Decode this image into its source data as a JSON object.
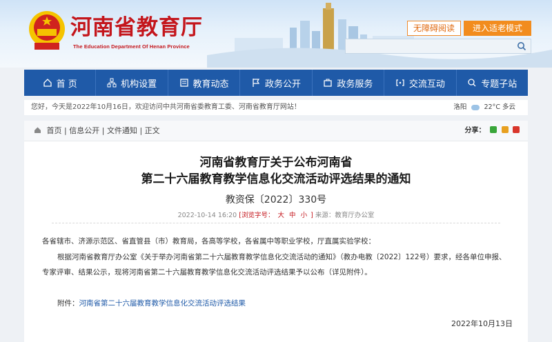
{
  "header": {
    "site_title": "河南省教育厅",
    "site_subtitle": "The Education Department Of Henan Province",
    "btn_accessible": "无障碍阅读",
    "btn_elder": "进入适老模式",
    "search_placeholder": ""
  },
  "nav": [
    {
      "label": "首 页",
      "icon": "home-icon"
    },
    {
      "label": "机构设置",
      "icon": "org-icon"
    },
    {
      "label": "教育动态",
      "icon": "news-icon"
    },
    {
      "label": "政务公开",
      "icon": "flag-icon"
    },
    {
      "label": "政务服务",
      "icon": "service-icon"
    },
    {
      "label": "交流互动",
      "icon": "chat-icon"
    },
    {
      "label": "专题子站",
      "icon": "topic-icon"
    }
  ],
  "welcome": {
    "text": "您好，今天是2022年10月16日，欢迎访问中共河南省委教育工委、河南省教育厅网站！",
    "city": "洛阳",
    "weather": "22°C 多云"
  },
  "breadcrumb": {
    "items": [
      "首页",
      "信息公开",
      "文件通知"
    ],
    "current": "正文",
    "sep": "|",
    "share_label": "分享："
  },
  "article": {
    "title_line1": "河南省教育厅关于公布河南省",
    "title_line2": "第二十六届教育教学信息化交流活动评选结果的通知",
    "doc_no": "教资保〔2022〕330号",
    "date": "2022-10-14 16:20",
    "font_size_label": "[浏览字号：",
    "font_large": "大",
    "font_mid": "中",
    "font_small": "小",
    "font_close": "]",
    "source": "来源：教育厅办公室",
    "para0": "各省辖市、济源示范区、省直管县（市）教育局，各高等学校，各省属中等职业学校，厅直属实验学校：",
    "para1": "根据河南省教育厅办公室《关于举办河南省第二十六届教育教学信息化交流活动的通知》（教办电教〔2022〕122号）要求，经各单位申报、",
    "para2": "专家评审、结果公示，现将河南省第二十六届教育教学信息化交流活动评选结果予以公布（详见附件）。",
    "attach_label": "附件：",
    "attach_link": "河南省第二十六届教育教学信息化交流活动评选结果",
    "sign_date": "2022年10月13日"
  },
  "colors": {
    "brand_red": "#c4161c",
    "nav_blue": "#1f5aa8",
    "accent_orange": "#f28c1e"
  }
}
